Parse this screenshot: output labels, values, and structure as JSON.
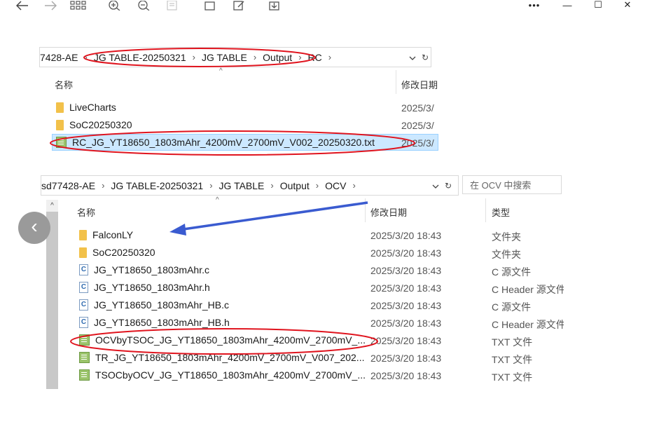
{
  "window": {
    "nav_icons": [
      "back-arrow-icon",
      "forward-arrow-icon",
      "view-grid-icon",
      "zoom-in-icon",
      "zoom-out-icon",
      "page-icon",
      "new-window-icon",
      "edit-icon",
      "download-icon"
    ],
    "controls": {
      "more": "•••",
      "minimize": "—",
      "maximize": "☐",
      "close": "✕"
    }
  },
  "top_pane": {
    "breadcrumb": [
      "7428-AE",
      "JG TABLE-20250321",
      "JG TABLE",
      "Output",
      "RC"
    ],
    "col_name": "名称",
    "col_date": "修改日期",
    "files": [
      {
        "name": "LiveCharts",
        "kind": "folder",
        "date": "2025/3/"
      },
      {
        "name": "SoC20250320",
        "kind": "folder",
        "date": "2025/3/"
      },
      {
        "name": "RC_JG_YT18650_1803mAhr_4200mV_2700mV_V002_20250320.txt",
        "kind": "txt",
        "date": "2025/3/",
        "selected": true
      }
    ]
  },
  "bottom_pane": {
    "breadcrumb": [
      "sd77428-AE",
      "JG TABLE-20250321",
      "JG TABLE",
      "Output",
      "OCV"
    ],
    "search_placeholder": "在 OCV 中搜索",
    "col_name": "名称",
    "col_date": "修改日期",
    "col_type": "类型",
    "files": [
      {
        "name": "FalconLY",
        "kind": "folder",
        "date": "2025/3/20 18:43",
        "type": "文件夹"
      },
      {
        "name": "SoC20250320",
        "kind": "folder",
        "date": "2025/3/20 18:43",
        "type": "文件夹"
      },
      {
        "name": "JG_YT18650_1803mAhr.c",
        "kind": "c",
        "date": "2025/3/20 18:43",
        "type": "C 源文件"
      },
      {
        "name": "JG_YT18650_1803mAhr.h",
        "kind": "c",
        "date": "2025/3/20 18:43",
        "type": "C Header 源文件"
      },
      {
        "name": "JG_YT18650_1803mAhr_HB.c",
        "kind": "c",
        "date": "2025/3/20 18:43",
        "type": "C 源文件"
      },
      {
        "name": "JG_YT18650_1803mAhr_HB.h",
        "kind": "c",
        "date": "2025/3/20 18:43",
        "type": "C Header 源文件"
      },
      {
        "name": "OCVbyTSOC_JG_YT18650_1803mAhr_4200mV_2700mV_...",
        "kind": "txt",
        "date": "2025/3/20 18:43",
        "type": "TXT 文件"
      },
      {
        "name": "TR_JG_YT18650_1803mAhr_4200mV_2700mV_V007_202...",
        "kind": "txt",
        "date": "2025/3/20 18:43",
        "type": "TXT 文件"
      },
      {
        "name": "TSOCbyOCV_JG_YT18650_1803mAhr_4200mV_2700mV_...",
        "kind": "txt",
        "date": "2025/3/20 18:43",
        "type": "TXT 文件"
      }
    ]
  },
  "annotation_color": "#e0141e",
  "arrow_color": "#3a5bd0",
  "c_icon_glyph": "C",
  "overlay_back": "‹"
}
